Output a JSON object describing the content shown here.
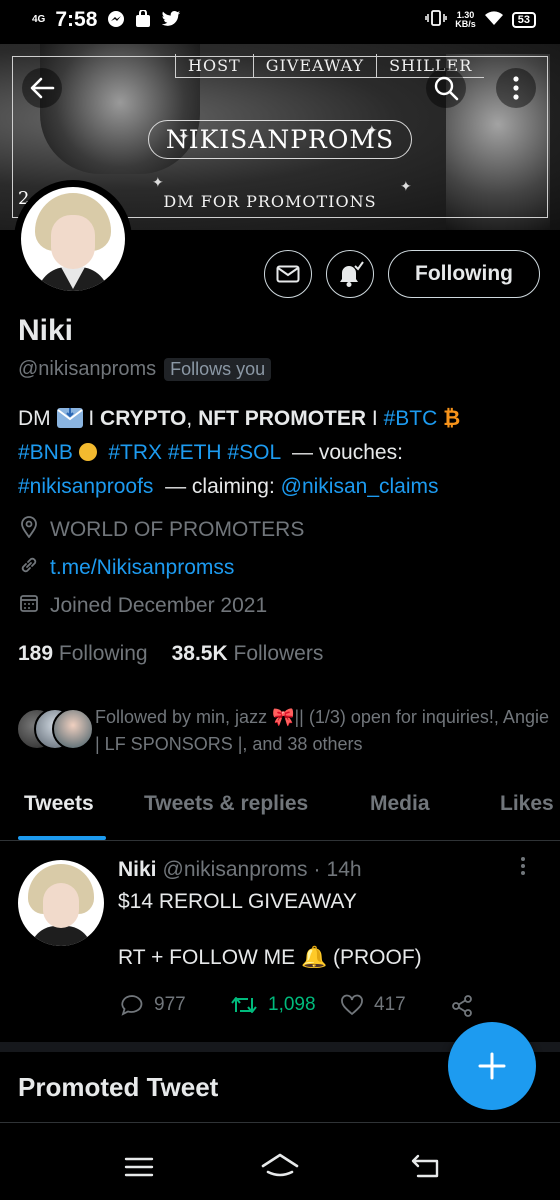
{
  "status_bar": {
    "network": "4G",
    "time": "7:58",
    "speed": "1.30\nKB/s",
    "battery": "53"
  },
  "banner": {
    "menu": [
      "HOST",
      "GIVEAWAY",
      "SHILLER"
    ],
    "title": "NIKISANPROMS",
    "subtitle": "DM FOR PROMOTIONS",
    "corner_number": "2"
  },
  "profile": {
    "name": "Niki",
    "handle": "@nikisanproms",
    "follows_you": "Follows you",
    "following_button": "Following",
    "bio": {
      "dm": "DM",
      "sep1": " I ",
      "crypto": "CRYPTO",
      "comma": ", ",
      "nft": "NFT PROMOTER",
      "sep2": " I ",
      "btc": "#BTC",
      "bnb": "#BNB",
      "trx": "#TRX",
      "eth": "#ETH",
      "sol": "#SOL",
      "vouches": "— vouches:",
      "proofs": "#nikisanproofs",
      "claiming": "— claiming:",
      "claims": "@nikisan_claims"
    },
    "location": "WORLD OF PROMOTERS",
    "link": "t.me/Nikisanpromss",
    "joined": "Joined December 2021",
    "following_count": "189",
    "following_label": "Following",
    "followers_count": "38.5K",
    "followers_label": "Followers",
    "followed_by": "Followed by min, jazz 🎀|| (1/3) open for inquiries!, Angie | LF SPONSORS |, and 38 others"
  },
  "tabs": [
    "Tweets",
    "Tweets & replies",
    "Media",
    "Likes"
  ],
  "tweet": {
    "name": "Niki",
    "handle": "@nikisanproms",
    "dot": "·",
    "time": "14h",
    "line1": "$14 REROLL GIVEAWAY",
    "line2": "RT + FOLLOW ME 🔔 (PROOF)",
    "replies": "977",
    "retweets": "1,098",
    "likes": "417"
  },
  "promoted_label": "Promoted Tweet",
  "colors": {
    "accent": "#1d9bf0",
    "retweet": "#00ba7c",
    "muted": "#71767b"
  }
}
